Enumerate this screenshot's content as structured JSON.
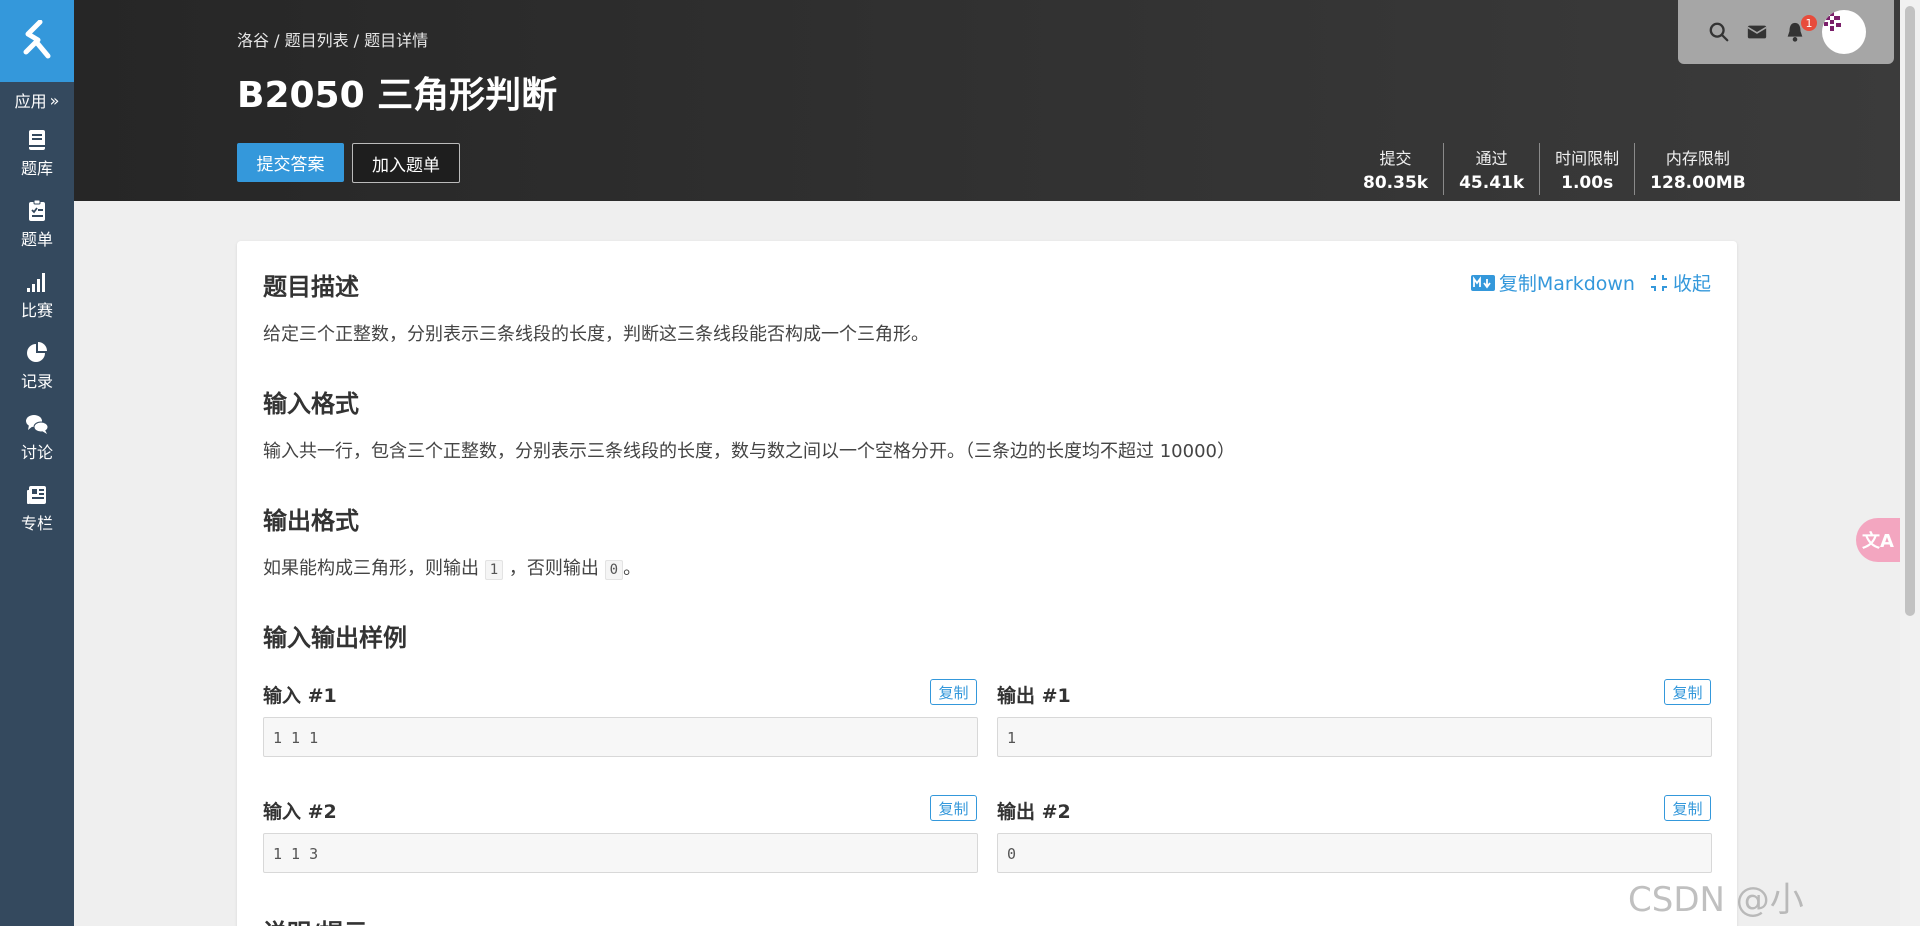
{
  "sidebar": {
    "app_label": "应用",
    "items": [
      {
        "label": "题库",
        "icon": "book-icon"
      },
      {
        "label": "题单",
        "icon": "clipboard-icon"
      },
      {
        "label": "比赛",
        "icon": "bar-signal-icon"
      },
      {
        "label": "记录",
        "icon": "pie-chart-icon"
      },
      {
        "label": "讨论",
        "icon": "chat-icon"
      },
      {
        "label": "专栏",
        "icon": "newspaper-icon"
      }
    ]
  },
  "header": {
    "breadcrumb": "洛谷 / 题目列表 / 题目详情",
    "title": "B2050 三角形判断",
    "submit_label": "提交答案",
    "add_label": "加入题单",
    "stats": [
      {
        "label": "提交",
        "value": "80.35k"
      },
      {
        "label": "通过",
        "value": "45.41k"
      },
      {
        "label": "时间限制",
        "value": "1.00s"
      },
      {
        "label": "内存限制",
        "value": "128.00MB"
      }
    ],
    "notification_count": "1"
  },
  "problem": {
    "copy_markdown": "复制Markdown",
    "collapse": "收起",
    "description_title": "题目描述",
    "description": "给定三个正整数，分别表示三条线段的长度，判断这三条线段能否构成一个三角形。",
    "input_title": "输入格式",
    "input_text": "输入共一行，包含三个正整数，分别表示三条线段的长度，数与数之间以一个空格分开。（三条边的长度均不超过 10000）",
    "output_title": "输出格式",
    "output_prefix": "如果能构成三角形，则输出",
    "output_code1": "1",
    "output_mid": "，否则输出",
    "output_code2": "0",
    "output_suffix": "。",
    "samples_title": "输入输出样例",
    "copy_label": "复制",
    "samples": [
      {
        "in_label": "输入 #1",
        "in": "1 1 1",
        "out_label": "输出 #1",
        "out": "1"
      },
      {
        "in_label": "输入 #2",
        "in": "1 1 3",
        "out_label": "输出 #2",
        "out": "0"
      }
    ],
    "hint_title": "说明/提示"
  },
  "floating": {
    "translate_label": "文A"
  },
  "watermark": "CSDN @小",
  "colors": {
    "accent": "#3498db",
    "sidebar": "#34495e",
    "badge": "#e74c3c"
  }
}
